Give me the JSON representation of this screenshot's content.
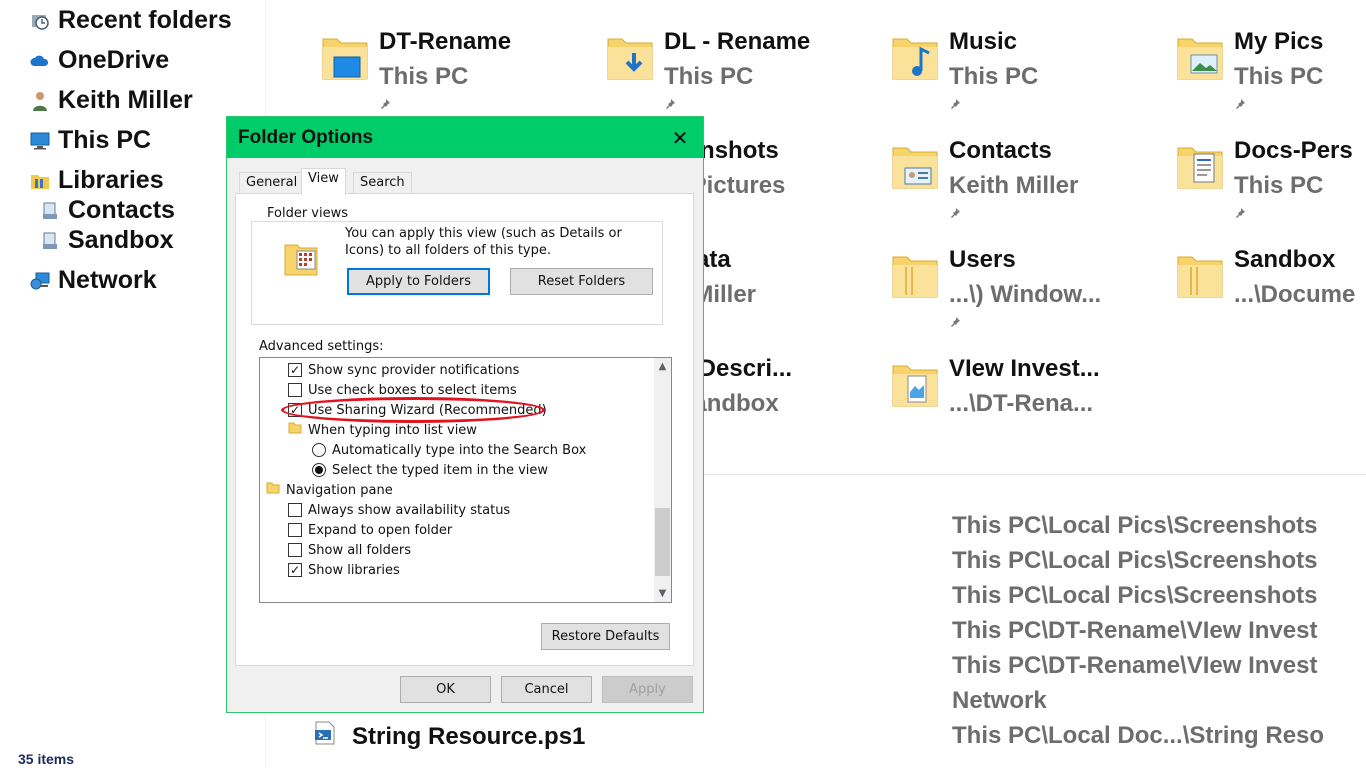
{
  "nav": {
    "items": [
      {
        "label": "Recent folders",
        "icon": "recent-folders-icon"
      },
      {
        "label": "OneDrive",
        "icon": "onedrive-icon"
      },
      {
        "label": "Keith Miller",
        "icon": "user-icon"
      },
      {
        "label": "This PC",
        "icon": "computer-icon"
      },
      {
        "label": "Libraries",
        "icon": "libraries-icon"
      },
      {
        "label": "Contacts",
        "icon": "library-icon"
      },
      {
        "label": "Sandbox",
        "icon": "library-icon"
      },
      {
        "label": "Network",
        "icon": "network-icon"
      }
    ],
    "status": "35 items"
  },
  "tiles": [
    {
      "name": "DT-Rename",
      "location": "This PC",
      "icon": "desktop-folder-icon",
      "pinned": true
    },
    {
      "name": "DL - Rename",
      "location": "This PC",
      "icon": "downloads-folder-icon",
      "pinned": true
    },
    {
      "name": "Music",
      "location": "This PC",
      "icon": "music-folder-icon",
      "pinned": true
    },
    {
      "name": "My Pics",
      "location": "This PC",
      "icon": "pictures-folder-icon",
      "pinned": true
    },
    {
      "name": "reenshots",
      "location": "...\\Pictures",
      "icon": "folder-icon",
      "pinned": false
    },
    {
      "name": "Contacts",
      "location": "Keith Miller",
      "icon": "contacts-folder-icon",
      "pinned": true
    },
    {
      "name": "Docs-Pers",
      "location": "This PC",
      "icon": "documents-folder-icon",
      "pinned": true
    },
    {
      "name": "pData",
      "location": "th Miller",
      "icon": "folder-icon",
      "pinned": false
    },
    {
      "name": "Users",
      "location": "...\\) Window...",
      "icon": "folder-icon",
      "pinned": true
    },
    {
      "name": "Sandbox",
      "location": "...\\Docume",
      "icon": "folder-icon",
      "pinned": false
    },
    {
      "name": "pe Descri...",
      "location": ".\\Sandbox",
      "icon": "folder-icon",
      "pinned": false
    },
    {
      "name": "VIew Invest...",
      "location": "...\\DT-Rena...",
      "icon": "file-folder-icon",
      "pinned": false
    }
  ],
  "recent_paths": [
    "This PC\\Local Pics\\Screenshots",
    "This PC\\Local Pics\\Screenshots",
    "This PC\\Local Pics\\Screenshots",
    "This PC\\DT-Rename\\VIew Invest",
    "This PC\\DT-Rename\\VIew Invest",
    "Network",
    "This PC\\Local Doc...\\String Reso"
  ],
  "recent_file": {
    "name": "String Resource.ps1",
    "icon": "script-file-icon"
  },
  "dialog": {
    "title": "Folder Options",
    "close_icon": "close-icon",
    "tabs": [
      "General",
      "View",
      "Search"
    ],
    "active_tab": "View",
    "folder_views": {
      "legend": "Folder views",
      "description": "You can apply this view (such as Details or Icons) to all folders of this type.",
      "apply_button": "Apply to Folders",
      "reset_button": "Reset Folders"
    },
    "advanced_label": "Advanced settings:",
    "advanced_items": [
      {
        "type": "checkbox",
        "label": "Show sync provider notifications",
        "checked": true
      },
      {
        "type": "checkbox",
        "label": "Use check boxes to select items",
        "checked": false
      },
      {
        "type": "checkbox",
        "label": "Use Sharing Wizard (Recommended)",
        "checked": true
      },
      {
        "type": "group",
        "label": "When typing into list view"
      },
      {
        "type": "radio",
        "label": "Automatically type into the Search Box",
        "checked": false
      },
      {
        "type": "radio",
        "label": "Select the typed item in the view",
        "checked": true
      },
      {
        "type": "group",
        "label": "Navigation pane"
      },
      {
        "type": "checkbox",
        "label": "Always show availability status",
        "checked": false
      },
      {
        "type": "checkbox",
        "label": "Expand to open folder",
        "checked": false
      },
      {
        "type": "checkbox",
        "label": "Show all folders",
        "checked": false
      },
      {
        "type": "checkbox",
        "label": "Show libraries",
        "checked": true
      }
    ],
    "restore_button": "Restore Defaults",
    "ok_button": "OK",
    "cancel_button": "Cancel",
    "apply_button": "Apply",
    "highlight_color": "#e0131e",
    "titlebar_color": "#00cc6a"
  }
}
